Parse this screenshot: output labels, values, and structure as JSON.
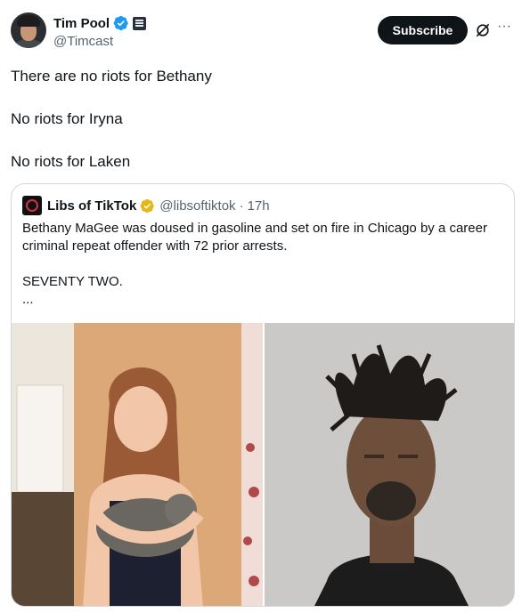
{
  "author": {
    "name": "Tim Pool",
    "handle": "@Timcast"
  },
  "actions": {
    "subscribe_label": "Subscribe",
    "grok_icon": "grok-icon",
    "more_label": "···"
  },
  "post": {
    "lines": [
      "There are no riots for Bethany",
      "No riots for Iryna",
      "No riots for Laken"
    ]
  },
  "quoted": {
    "name": "Libs of TikTok",
    "handle": "@libsoftiktok",
    "dot": "·",
    "time": "17h",
    "text": "Bethany MaGee was doused in gasoline and set on fire in Chicago by a career criminal repeat offender with 72 prior arrests.",
    "emphasis": "SEVENTY TWO.",
    "ellipsis": "..."
  },
  "colors": {
    "verified_blue": "#1d9bf0",
    "verified_gold": "#e2b719",
    "text": "#0f1419",
    "muted": "#536471",
    "border": "#cfd9de"
  }
}
